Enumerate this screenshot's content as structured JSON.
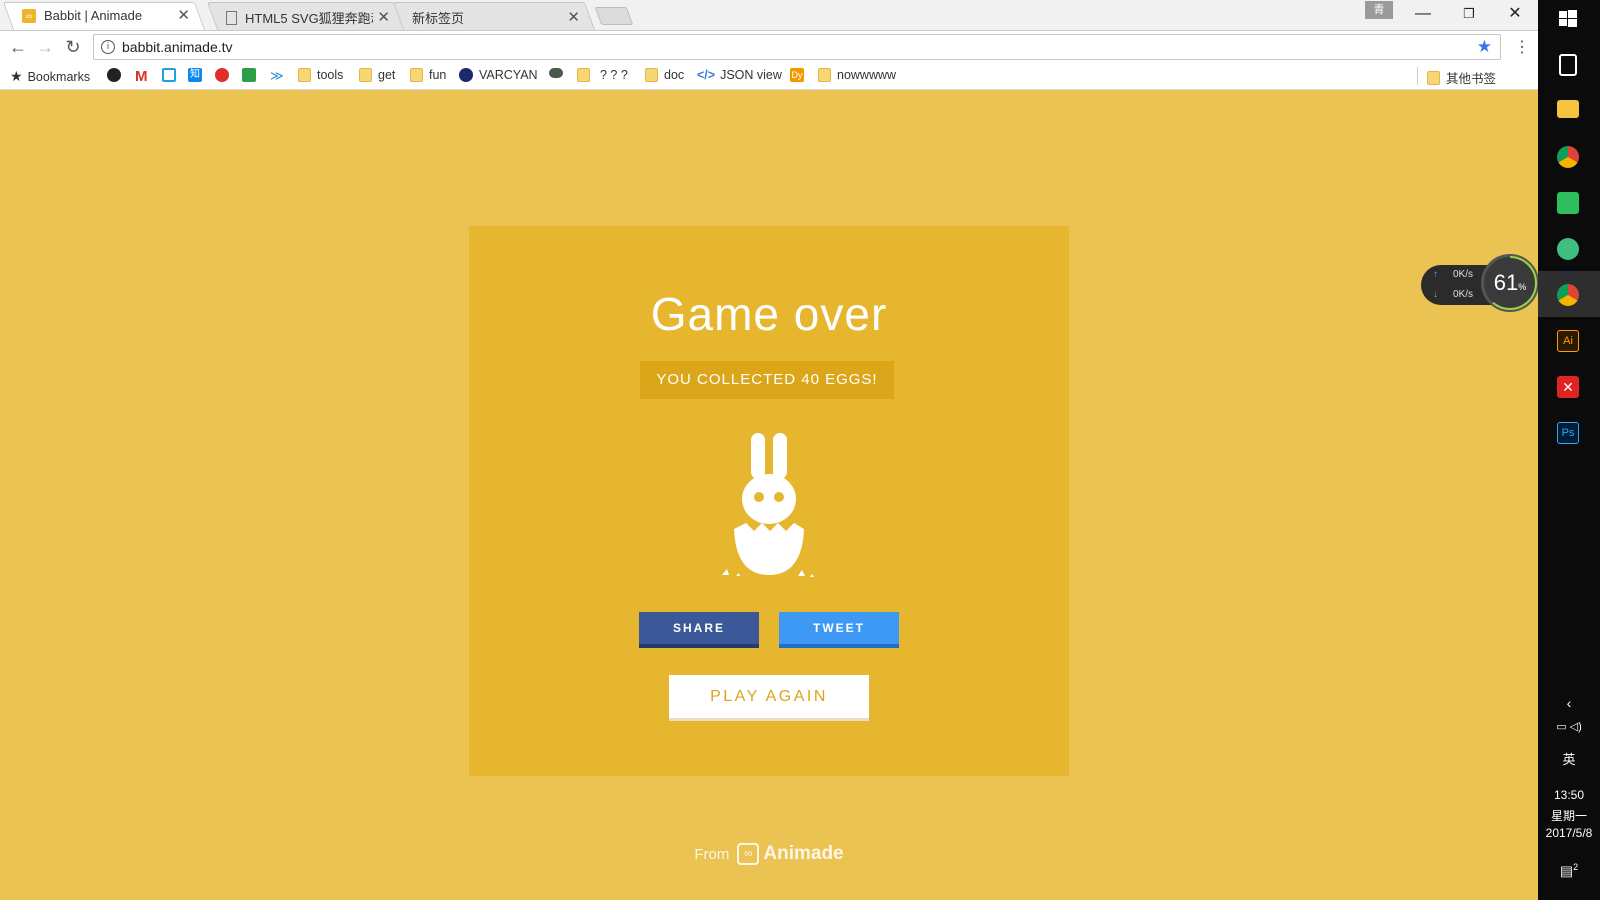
{
  "browser": {
    "tabs": [
      {
        "title": "Babbit | Animade",
        "active": true
      },
      {
        "title": "HTML5 SVG狐狸奔跑动",
        "active": false
      },
      {
        "title": "新标签页",
        "active": false
      }
    ],
    "profile_label": "青",
    "url": "babbit.animade.tv",
    "bookmarks_label": "Bookmarks",
    "bookmark_items": {
      "tools": "tools",
      "get": "get",
      "fun": "fun",
      "varcyan": "VARCYAN",
      "qqq": "? ? ?",
      "doc": "doc",
      "json": "JSON view",
      "nowwwww": "nowwwww",
      "other": "其他书签"
    }
  },
  "game": {
    "title": "Game over",
    "score_text": "YOU COLLECTED 40 EGGS!",
    "share_label": "SHARE",
    "tweet_label": "TWEET",
    "play_again_label": "PLAY AGAIN",
    "footer_from": "From",
    "footer_brand": "Animade"
  },
  "net_widget": {
    "upload": "0K/s",
    "download": "0K/s",
    "cpu_value": "61",
    "cpu_unit": "%"
  },
  "taskbar": {
    "ime": "英",
    "time": "13:50",
    "weekday": "星期一",
    "date": "2017/5/8",
    "notification_count": "2"
  },
  "colors": {
    "page_bg": "#ebc352",
    "card_bg": "#e5b62e",
    "facebook": "#3b5898",
    "twitter": "#3e99f4"
  }
}
